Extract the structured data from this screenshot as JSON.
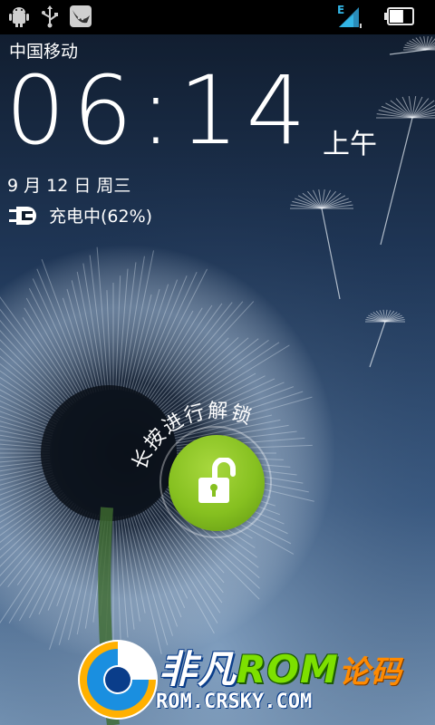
{
  "status_bar": {
    "icons": [
      "android-debug-icon",
      "usb-icon",
      "app-notification-icon",
      "signal-edge-icon",
      "battery-icon"
    ],
    "network_type": "E"
  },
  "lockscreen": {
    "carrier": "中国移动",
    "time": "06:14",
    "ampm": "上午",
    "date": "9 月 12 日 周三",
    "charging_text": "充电中(62%)",
    "battery_level": 0.62,
    "unlock_hint": "长按进行解锁"
  },
  "watermark": {
    "name_part1": "非凡",
    "name_part2": "ROM",
    "name_part3": "论码",
    "url": "ROM.CRSKY.COM"
  },
  "colors": {
    "unlock_green": "#86c020",
    "status_bar_bg": "#000000",
    "signal_blue": "#33b5e5"
  }
}
